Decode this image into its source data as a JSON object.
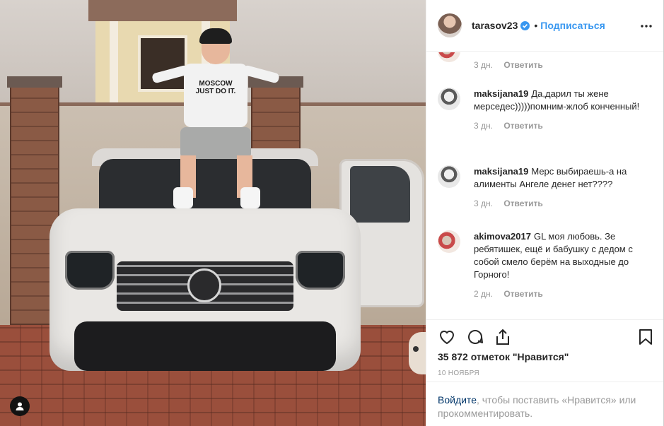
{
  "post": {
    "username": "tarasov23",
    "verified": true,
    "separator": "•",
    "follow_label": "Подписаться",
    "shirt_text": "MOSCOW\nJUST DO IT."
  },
  "comments": [
    {
      "username": "",
      "text": "",
      "time": "3 дн.",
      "reply_label": "Ответить"
    },
    {
      "username": "maksijana19",
      "text": "Да,дарил ты жене мерседес)))))помним-жлоб конченный!",
      "time": "3 дн.",
      "reply_label": "Ответить"
    },
    {
      "username": "maksijana19",
      "text": "Мерс выбираешь-а на алименты Ангеле денег нет????",
      "time": "3 дн.",
      "reply_label": "Ответить"
    },
    {
      "username": "akimova2017",
      "text": "GL моя любовь. Зе ребятишек, ещё и бабушку с дедом с собой смело берём на выходные до Горного!",
      "time": "2 дн.",
      "reply_label": "Ответить"
    }
  ],
  "stats": {
    "likes": "35 872 отметок \"Нравится\"",
    "date": "10 НОЯБРЯ"
  },
  "login": {
    "link_label": "Войдите",
    "rest_text": ", чтобы поставить «Нравится» или прокомментировать."
  },
  "icons": {
    "like": "heart-icon",
    "comment": "comment-icon",
    "share": "share-icon",
    "save": "bookmark-icon",
    "more": "more-icon",
    "verified": "verified-badge-icon",
    "tag": "user-tag-icon"
  },
  "colors": {
    "accent": "#3897f0",
    "verified": "#3897f0",
    "text": "#262626",
    "muted": "#999999",
    "link": "#003569"
  }
}
